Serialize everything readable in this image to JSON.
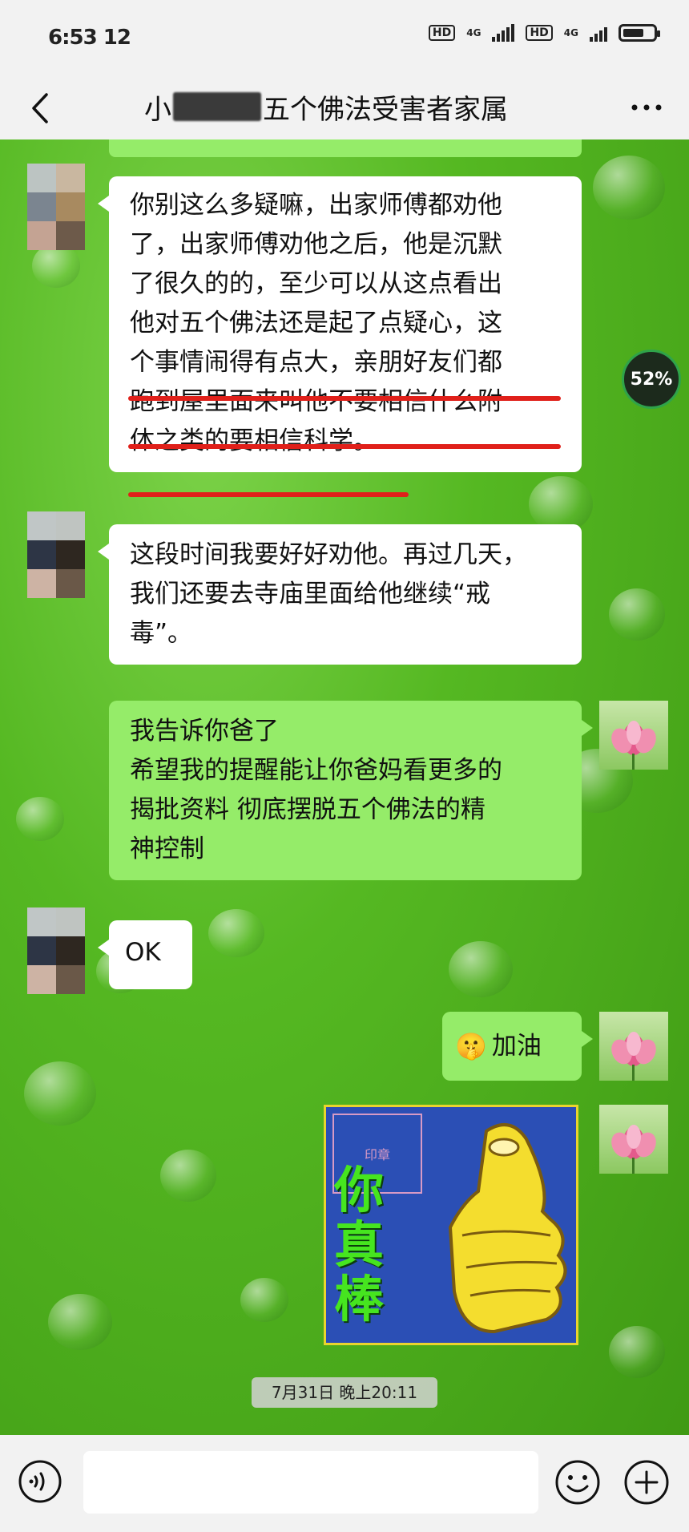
{
  "status_bar": {
    "time": "6:53 12",
    "hd_label": "HD",
    "network_1": "4G",
    "network_2": "4G",
    "hd_label_2": "HD",
    "battery_level": 0.7
  },
  "header": {
    "title_prefix": "小",
    "title_suffix": "五个佛法受害者家属"
  },
  "messages": [
    {
      "side": "left",
      "lines": [
        "你别这么多疑嘛，出家师傅都劝他",
        "了，出家师傅劝他之后，他是沉默",
        "了很久的的，至少可以从这点看出",
        "他对五个佛法还是起了点疑心，这",
        "个事情闹得有点大，亲朋好友们都",
        "跑到屋里面来叫他不要相信什么附",
        "体之类的要相信科学。"
      ]
    },
    {
      "side": "left",
      "lines": [
        "这段时间我要好好劝他。再过几天，",
        "我们还要去寺庙里面给他继续“戒",
        "毒”。"
      ]
    },
    {
      "side": "right",
      "lines": [
        "我告诉你爸了",
        "希望我的提醒能让你爸妈看更多的",
        "揭批资料 彻底摆脱五个佛法的精",
        "神控制"
      ]
    },
    {
      "side": "left",
      "lines": [
        "OK"
      ]
    },
    {
      "side": "right",
      "lines": [
        "加油"
      ],
      "emoji": "🤫"
    }
  ],
  "sticker": {
    "text": "你真棒",
    "seal_text": "印章"
  },
  "overlay": {
    "percent_badge": "52%"
  },
  "timestamp": "7月31日 晚上20:11",
  "input": {
    "placeholder": ""
  },
  "colors": {
    "bubble_right": "#95ec69",
    "bubble_left": "#ffffff",
    "underline": "#e0201a",
    "chat_bg": "#55b822"
  }
}
